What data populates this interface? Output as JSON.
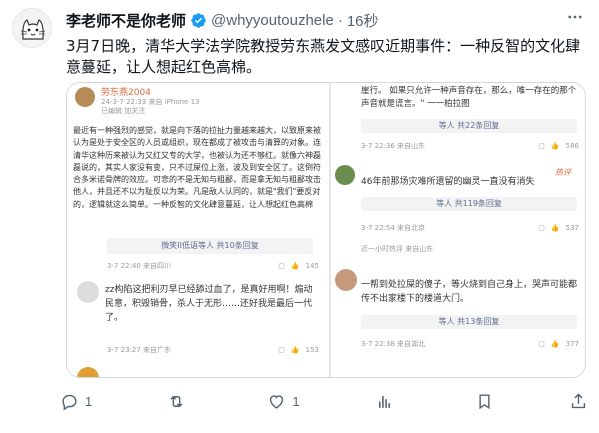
{
  "tweet": {
    "display_name": "李老师不是你老师",
    "handle": "@whyyoutouzhele",
    "separator": "·",
    "time": "16秒",
    "text": "3月7日晚，清华大学法学院教授劳东燕发文感叹近期事件：一种反智的文化肆意蔓延，让人想起红色高棉。"
  },
  "screenshot_left": {
    "user_name": "劳东燕2004",
    "meta_line1": "24-3-7 22:33 来自 iPhone 13",
    "meta_line2": "已编辑 加关注",
    "body": "最近有一种强烈的感觉，就是向下落的拉扯力量越来越大，以致原来被认为是处于安全区的人员或组织，现在都成了被攻击与清算的对象。连清华这种历来被认为又红又专的大学，也被认为还不够红。就像六神磊磊说的，其实人家没有变，只不过屎位上涨，波及到安全区了。这倒符合多米诺骨牌的效应。可悲的不是无知与粗鄙，而是拿无知与粗鄙攻击他人，并且还不以为耻反以为荣。凡是敌人认同的，就是\"我们\"要反对的，逻辑就这么简单。一种反智的文化肆意蔓延，让人想起红色高棉",
    "reply_box": "微笑II低语等人 共10条回复",
    "c1_time": "3-7 22:40 来自四川",
    "c1_likes": "145",
    "c2_text": "zz构陷这把利刃早已经舔过血了，是真好用啊！煽动民意，积毁销骨，杀人于无形……还好我是最后一代了。",
    "c2_time": "3-7 23:27 来自广东",
    "c2_likes": "153"
  },
  "screenshot_right": {
    "top_text": "崖行。  如果只允许一种声音存在，那么，唯一存在的那个声音就是谎言。\" 一一柏拉图",
    "r1_reply": "等人 共22条回复",
    "r1_time": "3-7 22:36 来自山东",
    "r1_likes": "586",
    "r2_text": "46年前那场灾难所遗留的幽灵一直没有消失",
    "r2_badge": "热评",
    "r2_reply": "等人 共119条回复",
    "r2_time": "3-7 22:54 来自北京",
    "r2_likes": "537",
    "r3_snippet": "近一小时热评 来自山东",
    "r4_text": "一帮到处拉屎的傻子，等火烧到自己身上，哭声可能都传不出家楼下的楼道大门。",
    "r4_reply": "等人 共13条回复",
    "r4_time": "3-7 22:38 来自湖北",
    "r4_likes": "377"
  },
  "actions": {
    "replies": "1",
    "retweets": "",
    "likes": "1",
    "views": "",
    "bookmarks": "",
    "share": ""
  }
}
